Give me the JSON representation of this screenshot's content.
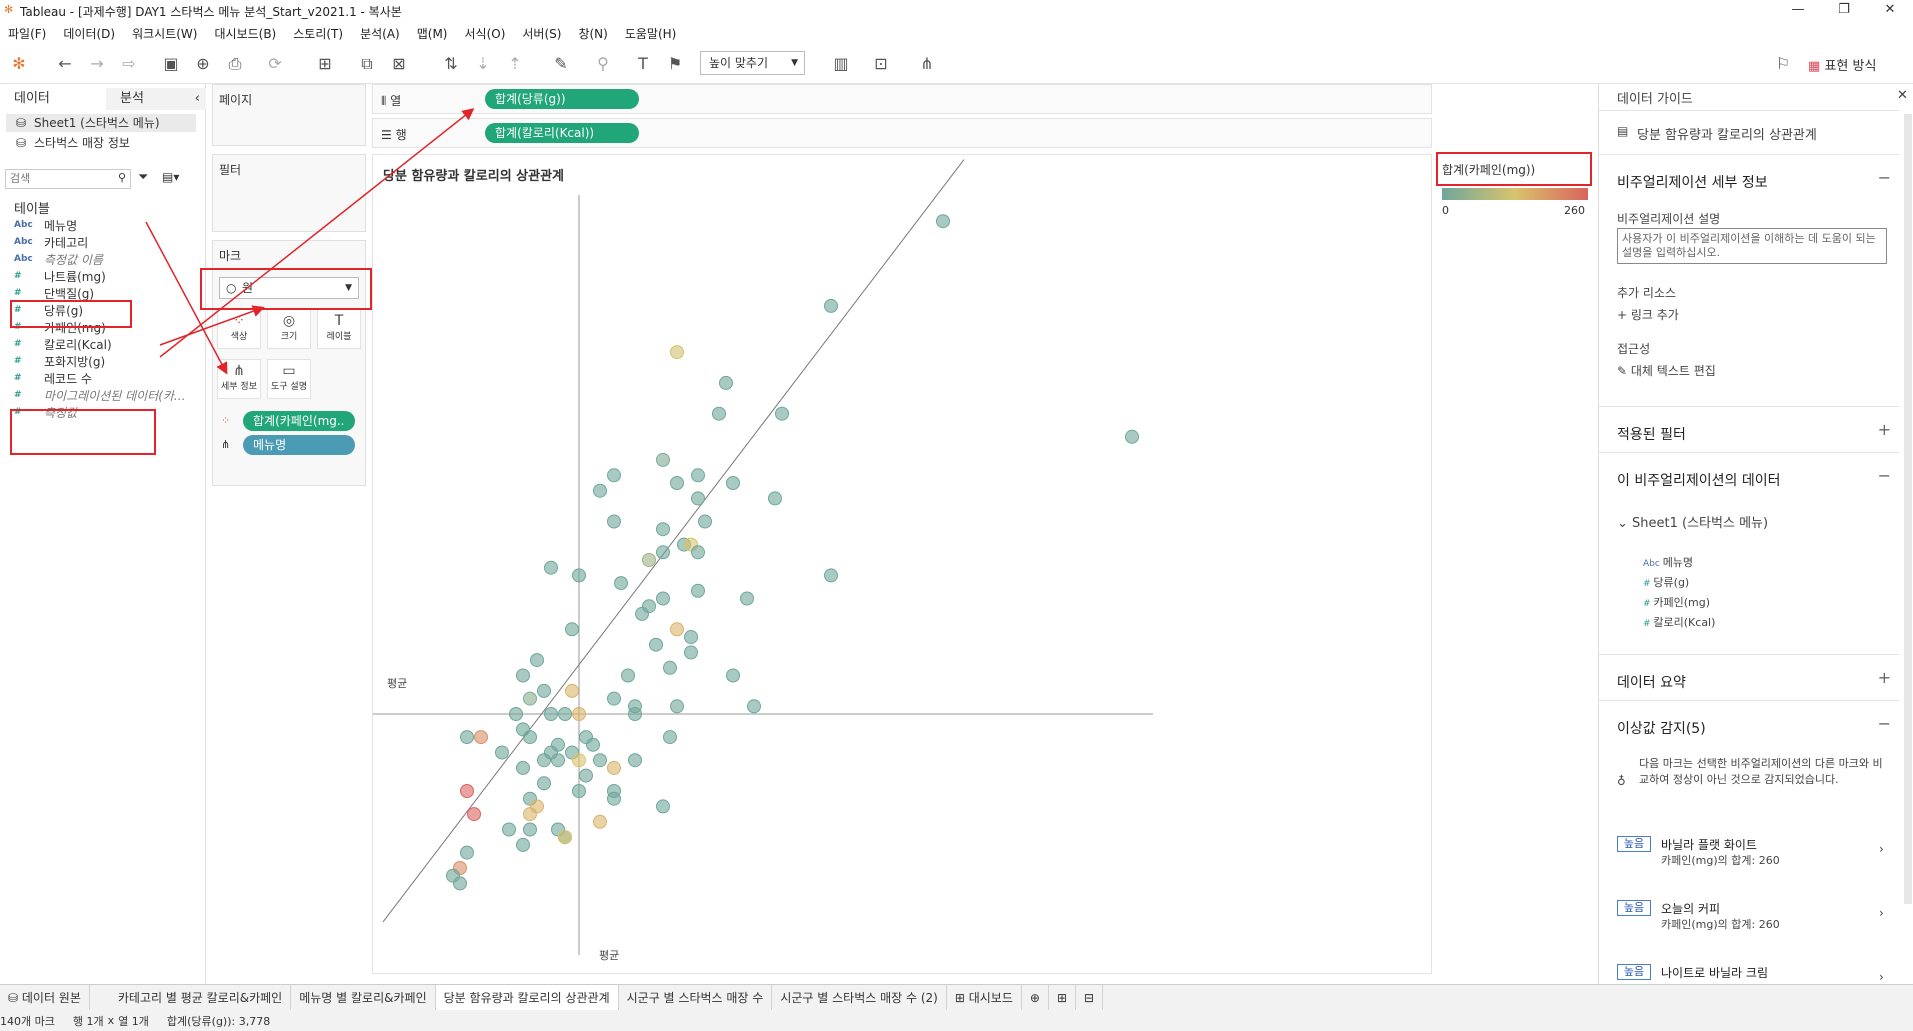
{
  "window": {
    "title": "Tableau - [과제수행] DAY1 스타벅스 메뉴 분석_Start_v2021.1 - 복사본"
  },
  "menu": [
    "파일(F)",
    "데이터(D)",
    "워크시트(W)",
    "대시보드(B)",
    "스토리(T)",
    "분석(A)",
    "맵(M)",
    "서식(O)",
    "서버(S)",
    "창(N)",
    "도움말(H)"
  ],
  "toolbar": {
    "fit_label": "높이 맞추기",
    "show_me_label": "표현 방식"
  },
  "left": {
    "tab_data": "데이터",
    "tab_analysis": "분석",
    "sources": [
      "Sheet1 (스타벅스 메뉴)",
      "스타벅스 매장 정보"
    ],
    "search_placeholder": "검색",
    "tables_header": "테이블",
    "fields": [
      {
        "type": "Abc",
        "name": "메뉴명"
      },
      {
        "type": "Abc",
        "name": "카테고리"
      },
      {
        "type": "Abc",
        "name": "측정값 이름"
      },
      {
        "type": "#",
        "name": "나트륨(mg)"
      },
      {
        "type": "#",
        "name": "단백질(g)"
      },
      {
        "type": "#",
        "name": "당류(g)"
      },
      {
        "type": "#",
        "name": "카페인(mg)"
      },
      {
        "type": "#",
        "name": "칼로리(Kcal)"
      },
      {
        "type": "#",
        "name": "포화지방(g)"
      },
      {
        "type": "#",
        "name": "레코드 수"
      },
      {
        "type": "#",
        "name": "마이그레이션된 데이터(카..."
      },
      {
        "type": "#",
        "name": "측정값"
      }
    ]
  },
  "cards": {
    "pages": "페이지",
    "filters": "필터",
    "marks": "마크",
    "mark_type": "원",
    "buttons": [
      "색상",
      "크기",
      "레이블",
      "세부 정보",
      "도구 설명"
    ],
    "mark_pills": [
      "합계(카페인(mg..",
      "메뉴명"
    ]
  },
  "shelves": {
    "columns_label": "열",
    "rows_label": "행",
    "columns_pill": "합계(당류(g))",
    "rows_pill": "합계(칼로리(Kcal))"
  },
  "legend": {
    "title": "합계(카페인(mg))",
    "min": "0",
    "max": "260"
  },
  "chart_data": {
    "type": "scatter",
    "title": "당분 함유량과 칼로리의 상관관계",
    "xlabel": "",
    "ylabel": "",
    "reference_line_label": "평균",
    "color_scale": [
      "#6fa79b",
      "#d8c36c",
      "#d9645f"
    ],
    "trend_line": true,
    "points_normalized_note": "x/y expressed in relative plot units (0-100)",
    "points": [
      [
        80,
        94,
        0
      ],
      [
        64,
        83,
        0
      ],
      [
        42,
        77,
        120
      ],
      [
        49,
        73,
        0
      ],
      [
        48,
        69,
        0
      ],
      [
        57,
        69,
        0
      ],
      [
        107,
        66,
        0
      ],
      [
        40,
        63,
        20
      ],
      [
        33,
        61,
        0
      ],
      [
        45,
        61,
        0
      ],
      [
        50,
        60,
        0
      ],
      [
        42,
        60,
        0
      ],
      [
        31,
        59,
        0
      ],
      [
        56,
        58,
        0
      ],
      [
        45,
        58,
        0
      ],
      [
        33,
        55,
        0
      ],
      [
        46,
        55,
        0
      ],
      [
        40,
        54,
        0
      ],
      [
        43,
        52,
        0
      ],
      [
        44,
        52,
        130
      ],
      [
        45,
        51,
        0
      ],
      [
        40,
        51,
        0
      ],
      [
        38,
        50,
        60
      ],
      [
        24,
        49,
        0
      ],
      [
        28,
        48,
        0
      ],
      [
        64,
        48,
        0
      ],
      [
        34,
        47,
        0
      ],
      [
        45,
        46,
        0
      ],
      [
        52,
        45,
        0
      ],
      [
        40,
        45,
        0
      ],
      [
        38,
        44,
        0
      ],
      [
        37,
        43,
        0
      ],
      [
        27,
        41,
        0
      ],
      [
        42,
        41,
        150
      ],
      [
        44,
        40,
        0
      ],
      [
        39,
        39,
        0
      ],
      [
        44,
        38,
        0
      ],
      [
        22,
        37,
        0
      ],
      [
        41,
        36,
        0
      ],
      [
        20,
        35,
        0
      ],
      [
        35,
        35,
        0
      ],
      [
        50,
        35,
        0
      ],
      [
        27,
        33,
        150
      ],
      [
        23,
        33,
        0
      ],
      [
        21,
        32,
        30
      ],
      [
        33,
        32,
        0
      ],
      [
        36,
        31,
        0
      ],
      [
        42,
        31,
        0
      ],
      [
        53,
        31,
        0
      ],
      [
        36,
        30,
        0
      ],
      [
        19,
        30,
        0
      ],
      [
        26,
        30,
        0
      ],
      [
        28,
        30,
        150
      ],
      [
        24,
        30,
        0
      ],
      [
        20,
        28,
        0
      ],
      [
        21,
        27,
        0
      ],
      [
        29,
        27,
        0
      ],
      [
        41,
        27,
        0
      ],
      [
        25,
        26,
        0
      ],
      [
        12,
        27,
        0
      ],
      [
        30,
        26,
        0
      ],
      [
        27,
        25,
        0
      ],
      [
        24,
        25,
        0
      ],
      [
        17,
        25,
        0
      ],
      [
        23,
        24,
        0
      ],
      [
        25,
        24,
        0
      ],
      [
        31,
        24,
        0
      ],
      [
        36,
        24,
        0
      ],
      [
        28,
        24,
        130
      ],
      [
        20,
        23,
        0
      ],
      [
        33,
        23,
        150
      ],
      [
        23,
        21,
        0
      ],
      [
        28,
        20,
        0
      ],
      [
        33,
        20,
        0
      ],
      [
        21,
        19,
        0
      ],
      [
        33,
        19,
        0
      ],
      [
        22,
        18,
        150
      ],
      [
        40,
        18,
        0
      ],
      [
        21,
        17,
        150
      ],
      [
        31,
        16,
        150
      ],
      [
        18,
        15,
        0
      ],
      [
        25,
        15,
        0
      ],
      [
        21,
        15,
        0
      ],
      [
        26,
        14,
        0
      ],
      [
        26,
        14,
        130
      ],
      [
        20,
        13,
        0
      ],
      [
        12,
        12,
        0
      ],
      [
        11,
        10,
        200
      ],
      [
        10,
        9,
        0
      ],
      [
        11,
        8,
        0
      ],
      [
        14,
        27,
        200
      ],
      [
        12,
        20,
        260
      ],
      [
        13,
        17,
        260
      ],
      [
        29,
        22,
        0
      ]
    ]
  },
  "guide": {
    "header": "데이터 가이드",
    "viz_title": "당분 함유량과 칼로리의 상관관계",
    "sec_details": "비주얼리제이션 세부 정보",
    "desc_label": "비주얼리제이션 설명",
    "desc_placeholder": "사용자가 이 비주얼리제이션을 이해하는 데 도움이 되는 설명을 입력하십시오.",
    "resources_label": "추가 리소스",
    "add_link": "링크 추가",
    "accessibility_label": "접근성",
    "alt_text": "대체 텍스트 편집",
    "sec_filters": "적용된 필터",
    "sec_data": "이 비주얼리제이션의 데이터",
    "sheet": "Sheet1 (스타벅스 메뉴)",
    "sheet_fields": [
      {
        "t": "Abc",
        "n": "메뉴명"
      },
      {
        "t": "#",
        "n": "당류(g)"
      },
      {
        "t": "#",
        "n": "카페인(mg)"
      },
      {
        "t": "#",
        "n": "칼로리(Kcal)"
      }
    ],
    "sec_summary": "데이터 요약",
    "sec_outliers": "이상값 감지(5)",
    "outlier_desc": "다음 마크는 선택한 비주얼리제이션의 다른 마크와 비교하여 정상이 아닌 것으로 감지되었습니다.",
    "badge": "높음",
    "outliers": [
      {
        "name": "바닐라 플랫 화이트",
        "value": "카페인(mg)의 합계: 260"
      },
      {
        "name": "오늘의 커피",
        "value": "카페인(mg)의 합계: 260"
      },
      {
        "name": "나이트로 바닐라 크림",
        "value": ""
      }
    ]
  },
  "tabs": [
    "데이터 원본",
    "카테고리 별 평균 칼로리&카페인",
    "메뉴명 별 칼로리&카페인",
    "당분 함유량과 칼로리의 상관관계",
    "시군구 별 스타벅스 매장 수",
    "시군구 별 스타벅스 매장 수 (2)",
    "대시보드"
  ],
  "status": {
    "marks": "140개 마크",
    "rows": "행 1개",
    "x": "x",
    "cols": "열 1개",
    "sum": "합계(당류(g)): 3,778"
  }
}
